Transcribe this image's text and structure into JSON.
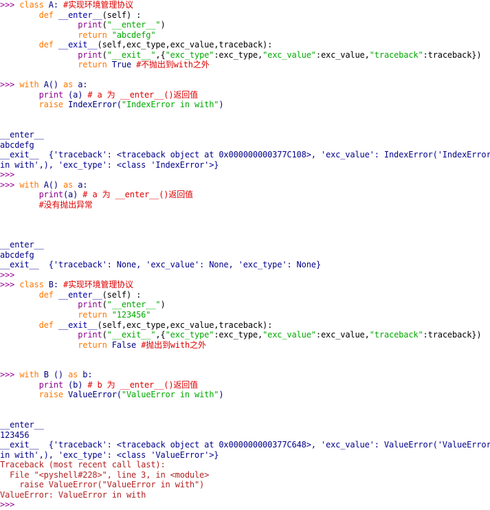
{
  "window": {
    "title": "Python 3 Shell",
    "prompt": ">>>"
  },
  "colors": {
    "background": "#ffffff",
    "prompt": "#990099",
    "keyword": "#ff7700",
    "builtin": "#900090",
    "string": "#00aa00",
    "comment": "#dd0000",
    "code": "#000080",
    "stdout": "#00008b",
    "stderr": "#b22222"
  },
  "lines": [
    {
      "id": "l1",
      "segs": [
        {
          "c": "prompt",
          "t": ">>> "
        },
        {
          "c": "kw",
          "t": "class"
        },
        {
          "c": "code",
          "t": " A: "
        },
        {
          "c": "comment",
          "t": "#实现环境管理协议"
        }
      ]
    },
    {
      "id": "l2",
      "segs": [
        {
          "c": "plain",
          "t": "        "
        },
        {
          "c": "kw",
          "t": "def"
        },
        {
          "c": "def",
          "t": " __enter__"
        },
        {
          "c": "plain",
          "t": "(self) :"
        }
      ]
    },
    {
      "id": "l3",
      "segs": [
        {
          "c": "plain",
          "t": "                "
        },
        {
          "c": "builtin",
          "t": "print"
        },
        {
          "c": "plain",
          "t": "("
        },
        {
          "c": "str",
          "t": "\"__enter__\""
        },
        {
          "c": "plain",
          "t": ")"
        }
      ]
    },
    {
      "id": "l4",
      "segs": [
        {
          "c": "plain",
          "t": "                "
        },
        {
          "c": "kw",
          "t": "return"
        },
        {
          "c": "plain",
          "t": " "
        },
        {
          "c": "str",
          "t": "\"abcdefg\""
        }
      ]
    },
    {
      "id": "l5",
      "segs": [
        {
          "c": "plain",
          "t": "        "
        },
        {
          "c": "kw",
          "t": "def"
        },
        {
          "c": "def",
          "t": " __exit__"
        },
        {
          "c": "plain",
          "t": "(self,exc_type,exc_value,traceback):"
        }
      ]
    },
    {
      "id": "l6",
      "segs": [
        {
          "c": "plain",
          "t": "                "
        },
        {
          "c": "builtin",
          "t": "print"
        },
        {
          "c": "plain",
          "t": "("
        },
        {
          "c": "str",
          "t": "\"__exit__\""
        },
        {
          "c": "plain",
          "t": ",{"
        },
        {
          "c": "str",
          "t": "\"exc_type\""
        },
        {
          "c": "plain",
          "t": ":exc_type,"
        },
        {
          "c": "str",
          "t": "\"exc_value\""
        },
        {
          "c": "plain",
          "t": ":exc_value,"
        },
        {
          "c": "str",
          "t": "\"traceback\""
        },
        {
          "c": "plain",
          "t": ":traceback})"
        }
      ]
    },
    {
      "id": "l7",
      "segs": [
        {
          "c": "plain",
          "t": "                "
        },
        {
          "c": "kw",
          "t": "return"
        },
        {
          "c": "code",
          "t": " True "
        },
        {
          "c": "comment",
          "t": "#不抛出到with之外"
        }
      ]
    },
    {
      "id": "l8",
      "segs": []
    },
    {
      "id": "l9",
      "segs": [
        {
          "c": "prompt",
          "t": ">>> "
        },
        {
          "c": "kw",
          "t": "with"
        },
        {
          "c": "code",
          "t": " A() "
        },
        {
          "c": "kw",
          "t": "as"
        },
        {
          "c": "code",
          "t": " a:"
        }
      ]
    },
    {
      "id": "l10",
      "segs": [
        {
          "c": "plain",
          "t": "        "
        },
        {
          "c": "builtin",
          "t": "print"
        },
        {
          "c": "code",
          "t": " (a) "
        },
        {
          "c": "comment",
          "t": "# a 为 __enter__()返回值"
        }
      ]
    },
    {
      "id": "l11",
      "segs": [
        {
          "c": "plain",
          "t": "        "
        },
        {
          "c": "kw",
          "t": "raise"
        },
        {
          "c": "code",
          "t": " IndexError("
        },
        {
          "c": "str",
          "t": "\"IndexError in with\""
        },
        {
          "c": "code",
          "t": ")"
        }
      ]
    },
    {
      "id": "l12",
      "segs": []
    },
    {
      "id": "l13",
      "segs": []
    },
    {
      "id": "l14",
      "segs": [
        {
          "c": "output",
          "t": "__enter__"
        }
      ]
    },
    {
      "id": "l15",
      "segs": [
        {
          "c": "output",
          "t": "abcdefg"
        }
      ]
    },
    {
      "id": "l16",
      "segs": [
        {
          "c": "output",
          "t": "__exit__  {'traceback': <traceback object at 0x000000000377C108>, 'exc_value': IndexError('IndexError"
        }
      ]
    },
    {
      "id": "l17",
      "segs": [
        {
          "c": "output",
          "t": "in with',), 'exc_type': <class 'IndexError'>}"
        }
      ]
    },
    {
      "id": "l18",
      "segs": [
        {
          "c": "prompt",
          "t": ">>>"
        }
      ]
    },
    {
      "id": "l19",
      "segs": [
        {
          "c": "prompt",
          "t": ">>> "
        },
        {
          "c": "kw",
          "t": "with"
        },
        {
          "c": "code",
          "t": " A() "
        },
        {
          "c": "kw",
          "t": "as"
        },
        {
          "c": "code",
          "t": " a:"
        }
      ]
    },
    {
      "id": "l20",
      "segs": [
        {
          "c": "plain",
          "t": "        "
        },
        {
          "c": "builtin",
          "t": "print"
        },
        {
          "c": "code",
          "t": "(a) "
        },
        {
          "c": "comment",
          "t": "# a 为 __enter__()返回值"
        }
      ]
    },
    {
      "id": "l21",
      "segs": [
        {
          "c": "plain",
          "t": "        "
        },
        {
          "c": "comment",
          "t": "#没有抛出异常"
        }
      ]
    },
    {
      "id": "l22",
      "segs": []
    },
    {
      "id": "l23",
      "segs": []
    },
    {
      "id": "l24",
      "segs": []
    },
    {
      "id": "l25",
      "segs": [
        {
          "c": "output",
          "t": "__enter__"
        }
      ]
    },
    {
      "id": "l26",
      "segs": [
        {
          "c": "output",
          "t": "abcdefg"
        }
      ]
    },
    {
      "id": "l27",
      "segs": [
        {
          "c": "output",
          "t": "__exit__  {'traceback': None, 'exc_value': None, 'exc_type': None}"
        }
      ]
    },
    {
      "id": "l28",
      "segs": [
        {
          "c": "prompt",
          "t": ">>>"
        }
      ]
    },
    {
      "id": "l29",
      "segs": [
        {
          "c": "prompt",
          "t": ">>> "
        },
        {
          "c": "kw",
          "t": "class"
        },
        {
          "c": "code",
          "t": " B: "
        },
        {
          "c": "comment",
          "t": "#实现环境管理协议"
        }
      ]
    },
    {
      "id": "l30",
      "segs": [
        {
          "c": "plain",
          "t": "        "
        },
        {
          "c": "kw",
          "t": "def"
        },
        {
          "c": "def",
          "t": " __enter__"
        },
        {
          "c": "plain",
          "t": "(self) :"
        }
      ]
    },
    {
      "id": "l31",
      "segs": [
        {
          "c": "plain",
          "t": "                "
        },
        {
          "c": "builtin",
          "t": "print"
        },
        {
          "c": "plain",
          "t": "("
        },
        {
          "c": "str",
          "t": "\"__enter__\""
        },
        {
          "c": "plain",
          "t": ")"
        }
      ]
    },
    {
      "id": "l32",
      "segs": [
        {
          "c": "plain",
          "t": "                "
        },
        {
          "c": "kw",
          "t": "return"
        },
        {
          "c": "plain",
          "t": " "
        },
        {
          "c": "str",
          "t": "\"123456\""
        }
      ]
    },
    {
      "id": "l33",
      "segs": [
        {
          "c": "plain",
          "t": "        "
        },
        {
          "c": "kw",
          "t": "def"
        },
        {
          "c": "def",
          "t": " __exit__"
        },
        {
          "c": "plain",
          "t": "(self,exc_type,exc_value,traceback):"
        }
      ]
    },
    {
      "id": "l34",
      "segs": [
        {
          "c": "plain",
          "t": "                "
        },
        {
          "c": "builtin",
          "t": "print"
        },
        {
          "c": "plain",
          "t": "("
        },
        {
          "c": "str",
          "t": "\"__exit__\""
        },
        {
          "c": "plain",
          "t": ",{"
        },
        {
          "c": "str",
          "t": "\"exc_type\""
        },
        {
          "c": "plain",
          "t": ":exc_type,"
        },
        {
          "c": "str",
          "t": "\"exc_value\""
        },
        {
          "c": "plain",
          "t": ":exc_value,"
        },
        {
          "c": "str",
          "t": "\"traceback\""
        },
        {
          "c": "plain",
          "t": ":traceback})"
        }
      ]
    },
    {
      "id": "l35",
      "segs": [
        {
          "c": "plain",
          "t": "                "
        },
        {
          "c": "kw",
          "t": "return"
        },
        {
          "c": "code",
          "t": " False "
        },
        {
          "c": "comment",
          "t": "#抛出到with之外"
        }
      ]
    },
    {
      "id": "l36",
      "segs": []
    },
    {
      "id": "l37",
      "segs": []
    },
    {
      "id": "l38",
      "segs": [
        {
          "c": "prompt",
          "t": ">>> "
        },
        {
          "c": "kw",
          "t": "with"
        },
        {
          "c": "code",
          "t": " B () "
        },
        {
          "c": "kw",
          "t": "as"
        },
        {
          "c": "code",
          "t": " b:"
        }
      ]
    },
    {
      "id": "l39",
      "segs": [
        {
          "c": "plain",
          "t": "        "
        },
        {
          "c": "builtin",
          "t": "print"
        },
        {
          "c": "code",
          "t": " (b) "
        },
        {
          "c": "comment",
          "t": "# b 为 __enter__()返回值"
        }
      ]
    },
    {
      "id": "l40",
      "segs": [
        {
          "c": "plain",
          "t": "        "
        },
        {
          "c": "kw",
          "t": "raise"
        },
        {
          "c": "code",
          "t": " ValueError("
        },
        {
          "c": "str",
          "t": "\"ValueError in with\""
        },
        {
          "c": "code",
          "t": ")"
        }
      ]
    },
    {
      "id": "l41",
      "segs": []
    },
    {
      "id": "l42",
      "segs": []
    },
    {
      "id": "l43",
      "segs": [
        {
          "c": "output",
          "t": "__enter__"
        }
      ]
    },
    {
      "id": "l44",
      "segs": [
        {
          "c": "output",
          "t": "123456"
        }
      ]
    },
    {
      "id": "l45",
      "segs": [
        {
          "c": "output",
          "t": "__exit__  {'traceback': <traceback object at 0x000000000377C648>, 'exc_value': ValueError('ValueError"
        }
      ]
    },
    {
      "id": "l46",
      "segs": [
        {
          "c": "output",
          "t": "in with',), 'exc_type': <class 'ValueError'>}"
        }
      ]
    },
    {
      "id": "l47",
      "segs": [
        {
          "c": "err",
          "t": "Traceback (most recent call last):"
        }
      ]
    },
    {
      "id": "l48",
      "segs": [
        {
          "c": "err",
          "t": "  File \"<pyshell#228>\", line 3, in <module>"
        }
      ]
    },
    {
      "id": "l49",
      "segs": [
        {
          "c": "err",
          "t": "    raise ValueError(\"ValueError in with\")"
        }
      ]
    },
    {
      "id": "l50",
      "segs": [
        {
          "c": "err",
          "t": "ValueError: ValueError in with"
        }
      ]
    },
    {
      "id": "l51",
      "segs": [
        {
          "c": "prompt",
          "t": ">>>"
        }
      ]
    }
  ]
}
